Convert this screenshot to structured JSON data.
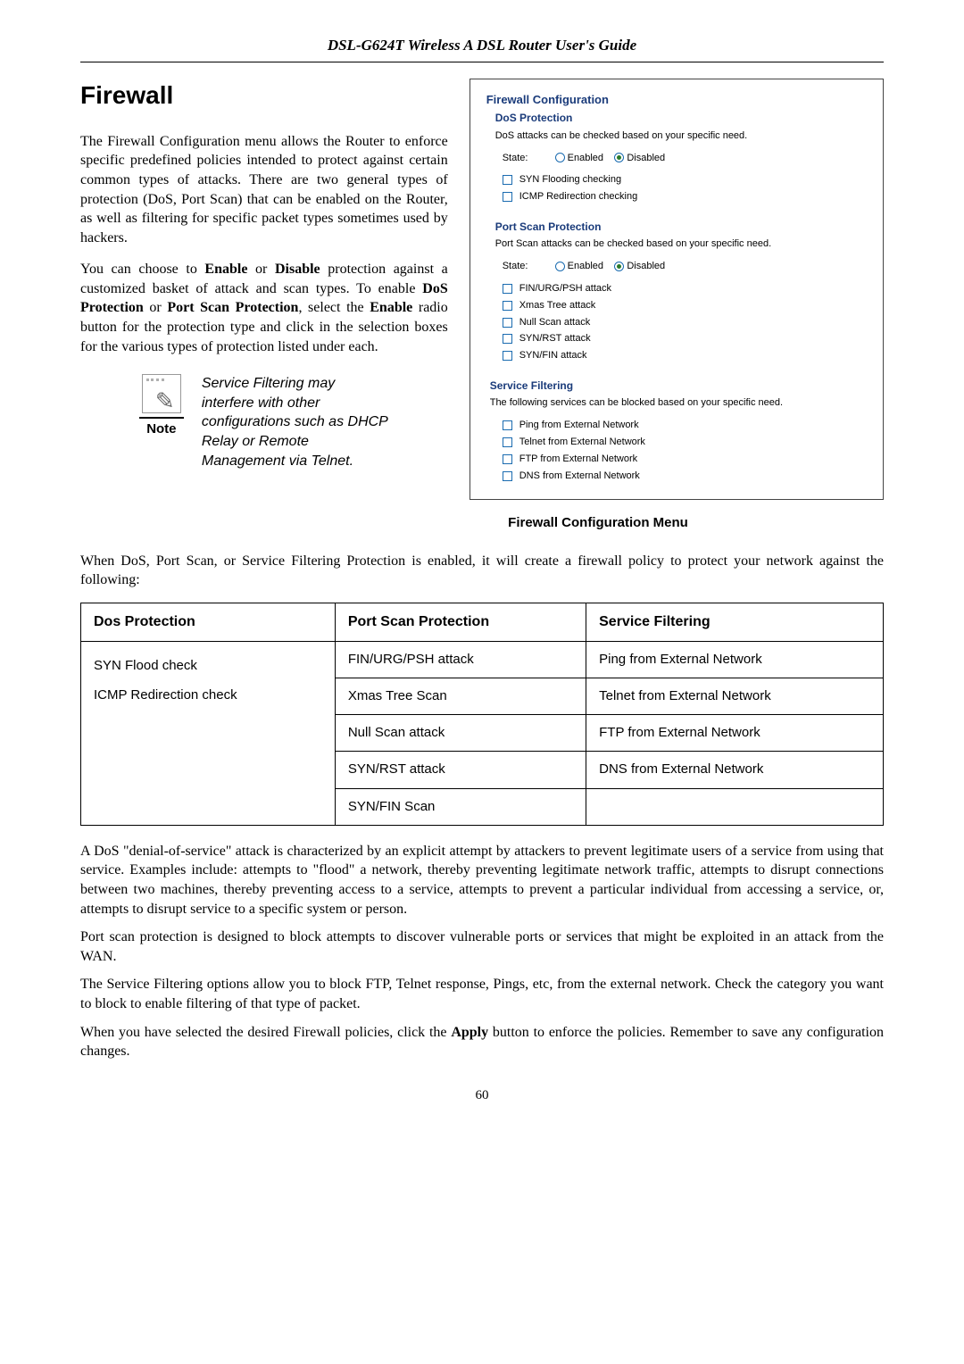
{
  "header": "DSL-G624T Wireless A DSL Router User's Guide",
  "title": "Firewall",
  "left": {
    "p1": "The Firewall Configuration menu allows the Router to enforce specific predefined policies intended to protect against certain common types of attacks. There are two general types of protection (DoS, Port Scan) that can be enabled on the Router, as well as filtering for specific packet types sometimes used by hackers.",
    "p2_a": "You can choose to ",
    "p2_enable": "Enable",
    "p2_b": " or ",
    "p2_disable": "Disable",
    "p2_c": " protection against a customized basket of attack and scan types. To enable ",
    "p2_dos": "DoS Protection",
    "p2_d": " or ",
    "p2_port": "Port Scan Protection",
    "p2_e": ", select the ",
    "p2_enable2": "Enable",
    "p2_f": " radio button for the protection type and click in the selection boxes for the various types of protection listed under each.",
    "note_label": "Note",
    "note_text": "Service Filtering may interfere with other configurations such as DHCP Relay or Remote Management via Telnet."
  },
  "config": {
    "panel_title": "Firewall Configuration",
    "dos": {
      "title": "DoS Protection",
      "desc": "DoS attacks can be checked based on your specific need.",
      "state_label": "State:",
      "enabled": "Enabled",
      "disabled": "Disabled",
      "items": [
        "SYN Flooding checking",
        "ICMP Redirection checking"
      ]
    },
    "portscan": {
      "title": "Port Scan Protection",
      "desc": "Port Scan attacks can be checked based on your specific need.",
      "state_label": "State:",
      "enabled": "Enabled",
      "disabled": "Disabled",
      "items": [
        "FIN/URG/PSH attack",
        "Xmas Tree attack",
        "Null Scan attack",
        "SYN/RST attack",
        "SYN/FIN attack"
      ]
    },
    "service": {
      "title": "Service Filtering",
      "desc": "The following services can be blocked based on your specific need.",
      "items": [
        "Ping from External Network",
        "Telnet from External Network",
        "FTP from External Network",
        "DNS from External Network"
      ]
    }
  },
  "caption": "Firewall Configuration Menu",
  "body": {
    "p3": "When DoS, Port Scan, or Service Filtering Protection is enabled, it will create a firewall policy to protect your network against the following:",
    "table": {
      "headers": [
        "Dos Protection",
        "Port Scan Protection",
        "Service Filtering"
      ],
      "rows": [
        [
          "SYN Flood check",
          "FIN/URG/PSH attack",
          "Ping from External Network"
        ],
        [
          "ICMP Redirection check",
          "Xmas Tree Scan",
          "Telnet from External Network"
        ],
        [
          "",
          "Null Scan attack",
          "FTP from External Network"
        ],
        [
          "",
          "SYN/RST attack",
          "DNS from External Network"
        ],
        [
          "",
          "SYN/FIN Scan",
          ""
        ]
      ]
    },
    "p4": "A DoS \"denial-of-service\" attack is characterized by an explicit attempt by attackers to prevent legitimate users of a service from using that service. Examples include: attempts to \"flood\" a network, thereby preventing legitimate network traffic, attempts to disrupt connections between two machines, thereby preventing access to a service, attempts to prevent a particular individual from accessing a service, or, attempts to disrupt service to a specific system or person.",
    "p5": "Port scan protection is designed to block attempts to discover vulnerable ports or services that might be exploited in an attack from the WAN.",
    "p6": "The Service Filtering options allow you to block FTP, Telnet response, Pings, etc, from the external network.  Check the category you want to block to enable filtering of that type of packet.",
    "p7_a": "When you have selected the desired Firewall policies, click the ",
    "p7_apply": "Apply",
    "p7_b": " button to enforce the policies. Remember to save any configuration changes."
  },
  "page_number": "60"
}
